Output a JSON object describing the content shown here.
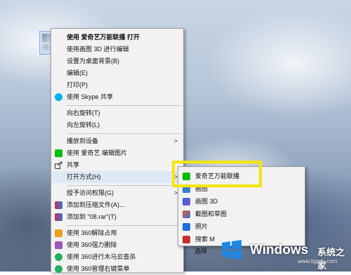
{
  "desktop": {
    "icon_label": "08."
  },
  "context_menu": {
    "items": [
      "使用 爱奇艺万能联播 打开",
      "使用画图 3D 进行编辑",
      "设置为桌面背景(B)",
      "编辑(E)",
      "打印(P)",
      "使用 Skype 共享",
      "向右旋转(T)",
      "向左旋转(L)",
      "播放到设备",
      "使用 爱奇艺 编辑图片",
      "共享",
      "打开方式(H)",
      "授予访问权限(G)",
      "添加到压缩文件(A)...",
      "添加到 \"08.rar\"(T)",
      "使用 360解除占用",
      "使用 360强力删除",
      "使用 360进行木马云查杀",
      "使用 360管理右键菜单"
    ]
  },
  "submenu": {
    "items": [
      "爱奇艺万能联播",
      "画图",
      "画图 3D",
      "截图和草图",
      "照片",
      "搜索 M",
      "选择"
    ]
  },
  "watermark": {
    "windows": "Windows",
    "cn": "系统之家",
    "site": "www.bjjmlv.com"
  },
  "colors": {
    "menu_bg": "#f2f2f2",
    "highlight": "#f6e500",
    "iqiyi_green": "#00be06",
    "skype_blue": "#00aff0"
  }
}
